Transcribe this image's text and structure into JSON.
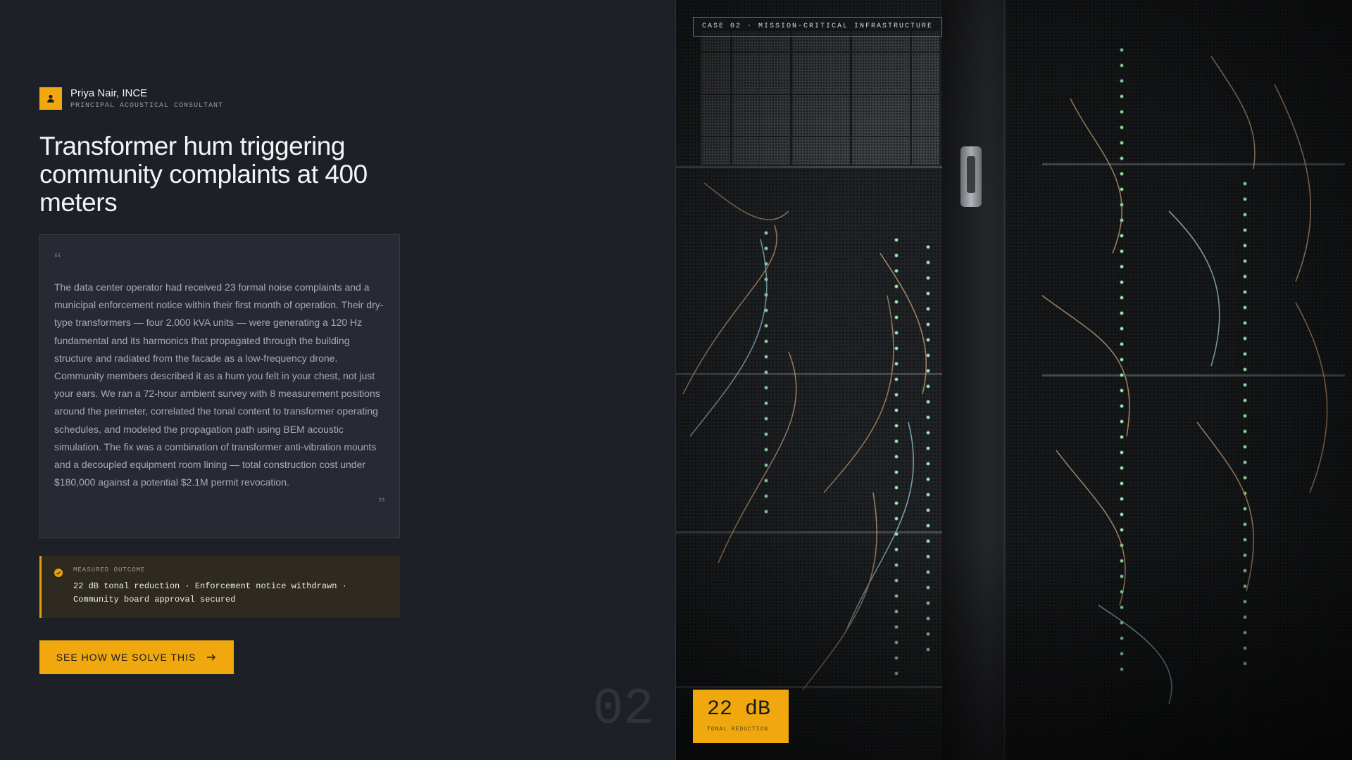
{
  "author": {
    "name": "Priya Nair, INCE",
    "role": "PRINCIPAL ACOUSTICAL CONSULTANT"
  },
  "headline": "Transformer hum triggering community complaints at 400 meters",
  "quote": {
    "open_mark": "“",
    "close_mark": "”",
    "text": "The data center operator had received 23 formal noise complaints and a municipal enforcement notice within their first month of operation. Their dry-type transformers — four 2,000 kVA units — were generating a 120 Hz fundamental and its harmonics that propagated through the building structure and radiated from the facade as a low-frequency drone. Community members described it as a hum you felt in your chest, not just your ears. We ran a 72-hour ambient survey with 8 measurement positions around the perimeter, correlated the tonal content to transformer operating schedules, and modeled the propagation path using BEM acoustic simulation. The fix was a combination of transformer anti-vibration mounts and a decoupled equipment room lining — total construction cost under $180,000 against a potential $2.1M permit revocation."
  },
  "outcome": {
    "label": "MEASURED OUTCOME",
    "text": "22 dB tonal reduction · Enforcement notice withdrawn · Community board approval secured"
  },
  "cta": {
    "label": "SEE HOW WE SOLVE THIS"
  },
  "case_number": "02",
  "image_panel": {
    "case_label": "CASE 02 · MISSION-CRITICAL INFRASTRUCTURE",
    "badge_value": "22 dB",
    "badge_label": "TONAL REDUCTION"
  },
  "colors": {
    "background": "#1e2027",
    "accent": "#f0a80e",
    "card": "#272a32",
    "outcome_bg": "#2e2a20"
  },
  "icons": {
    "avatar": "user-icon",
    "outcome": "check-circle-icon",
    "cta": "arrow-right-icon"
  }
}
